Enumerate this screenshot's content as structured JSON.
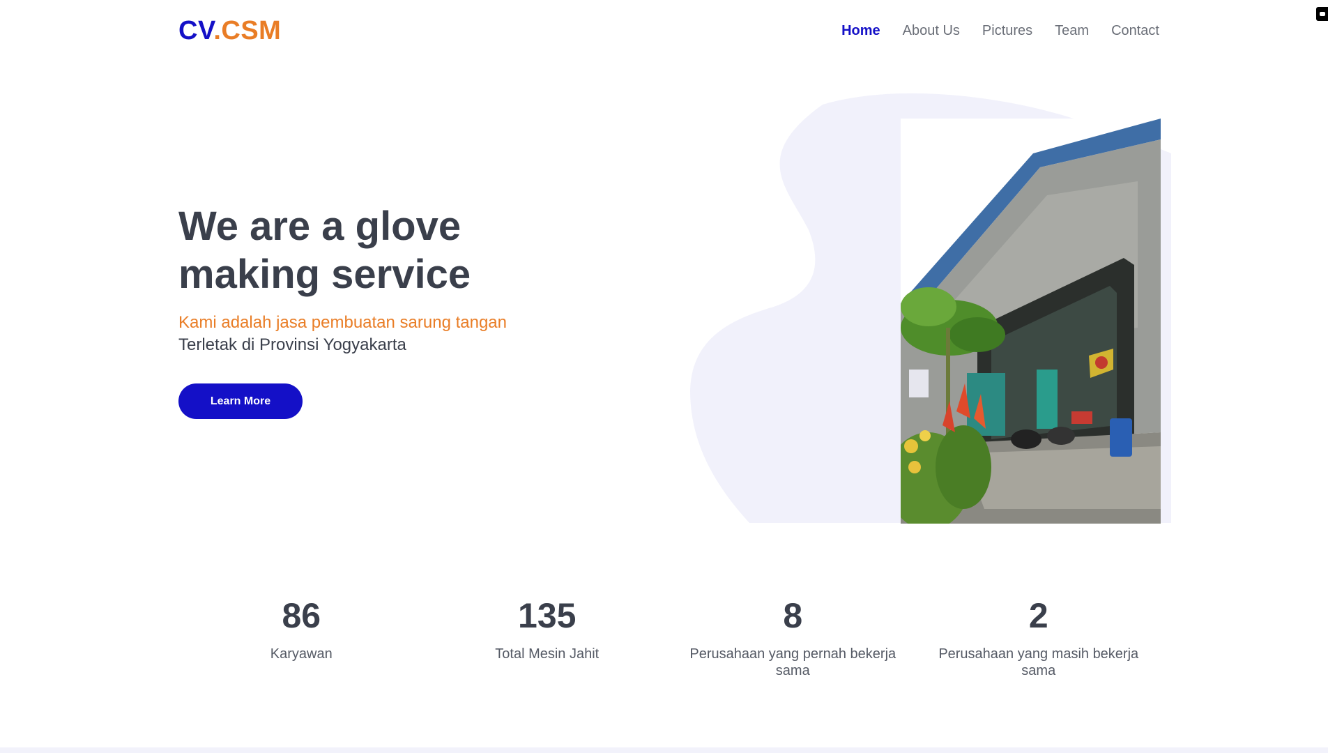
{
  "brand": {
    "part1": "CV",
    "dot": ".",
    "part2": "CSM",
    "color_primary": "#1410c7",
    "color_accent": "#e97d26"
  },
  "nav": {
    "items": [
      {
        "label": "Home",
        "active": true
      },
      {
        "label": "About Us",
        "active": false
      },
      {
        "label": "Pictures",
        "active": false
      },
      {
        "label": "Team",
        "active": false
      },
      {
        "label": "Contact",
        "active": false
      }
    ]
  },
  "hero": {
    "title": "We are a glove making service",
    "subtitle": "Kami adalah jasa pembuatan sarung tangan",
    "location": "Terletak di Provinsi Yogyakarta",
    "cta_label": "Learn More",
    "image_icon": "factory-building-photo"
  },
  "stats": [
    {
      "value": "86",
      "label": "Karyawan"
    },
    {
      "value": "135",
      "label": "Total Mesin Jahit"
    },
    {
      "value": "8",
      "label": "Perusahaan yang pernah bekerja sama"
    },
    {
      "value": "2",
      "label": "Perusahaan yang masih bekerja sama"
    }
  ]
}
